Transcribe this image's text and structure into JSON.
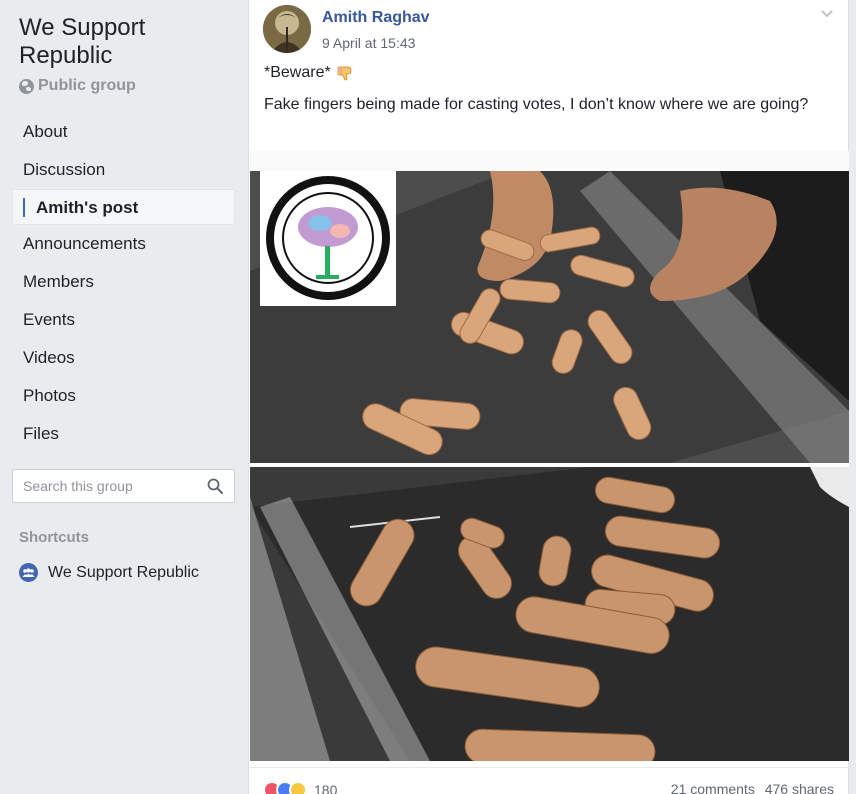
{
  "group": {
    "title": "We Support Republic",
    "privacy": "Public group",
    "privacy_icon": "globe-icon"
  },
  "nav": {
    "items": [
      {
        "label": "About"
      },
      {
        "label": "Discussion"
      },
      {
        "label": "Amith's post",
        "active": true
      },
      {
        "label": "Announcements"
      },
      {
        "label": "Members"
      },
      {
        "label": "Events"
      },
      {
        "label": "Videos"
      },
      {
        "label": "Photos"
      },
      {
        "label": "Files"
      }
    ]
  },
  "search": {
    "placeholder": "Search this group",
    "icon": "search-icon"
  },
  "shortcuts": {
    "title": "Shortcuts",
    "items": [
      {
        "label": "We Support Republic",
        "icon": "group-icon"
      }
    ]
  },
  "post": {
    "author": "Amith Raghav",
    "timestamp": "9 April at 15:43",
    "line1": "*Beware*",
    "line1_emoji": "thumbs-down-icon",
    "line2": "Fake fingers being made for casting votes, I don’t know where we are going?",
    "reaction_count": "180",
    "comments": "21 comments",
    "shares": "476 shares"
  },
  "colors": {
    "link_blue": "#385898",
    "accent_blue": "#4267b2",
    "muted_gray": "#90949c",
    "page_bg": "#e9ebee"
  }
}
